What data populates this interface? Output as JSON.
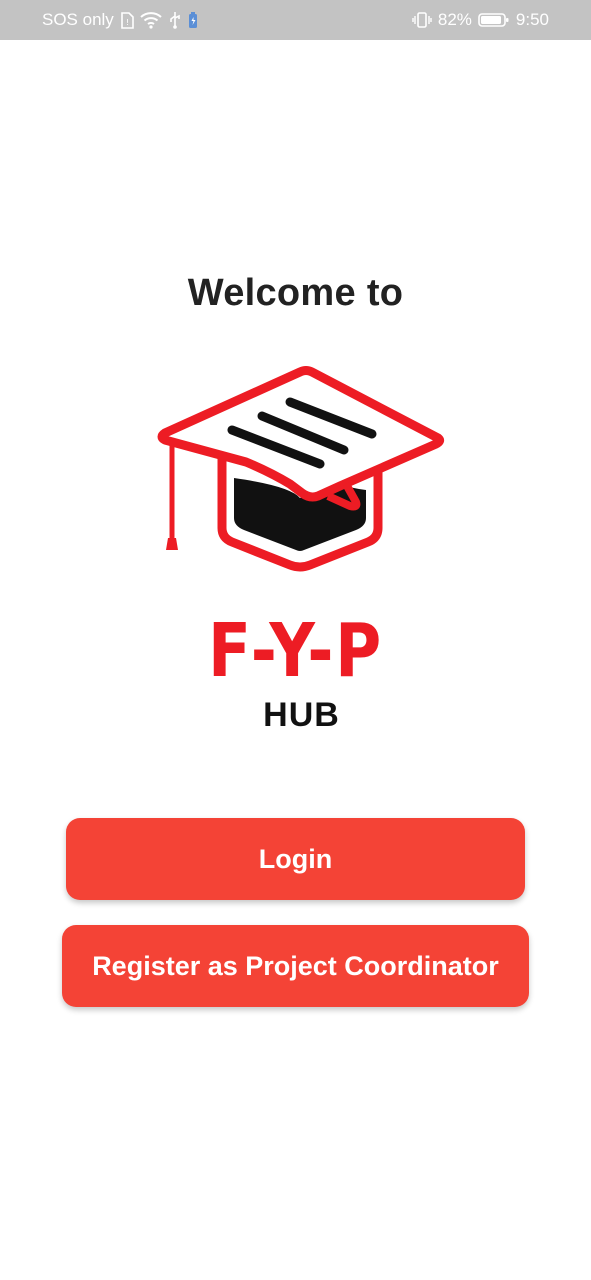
{
  "status_bar": {
    "carrier": "SOS only",
    "battery_percent": "82%",
    "time": "9:50",
    "icons": [
      "sim-icon",
      "wifi-icon",
      "usb-icon",
      "battery-saver-icon",
      "vibrate-icon",
      "battery-icon"
    ]
  },
  "welcome": {
    "heading": "Welcome to"
  },
  "logo": {
    "brand": "F-Y-P",
    "subtitle": "HUB",
    "colors": {
      "primary": "#ed1c24",
      "dark": "#111111"
    }
  },
  "actions": {
    "login_label": "Login",
    "register_label": "Register as Project Coordinator",
    "button_color": "#f44336"
  }
}
